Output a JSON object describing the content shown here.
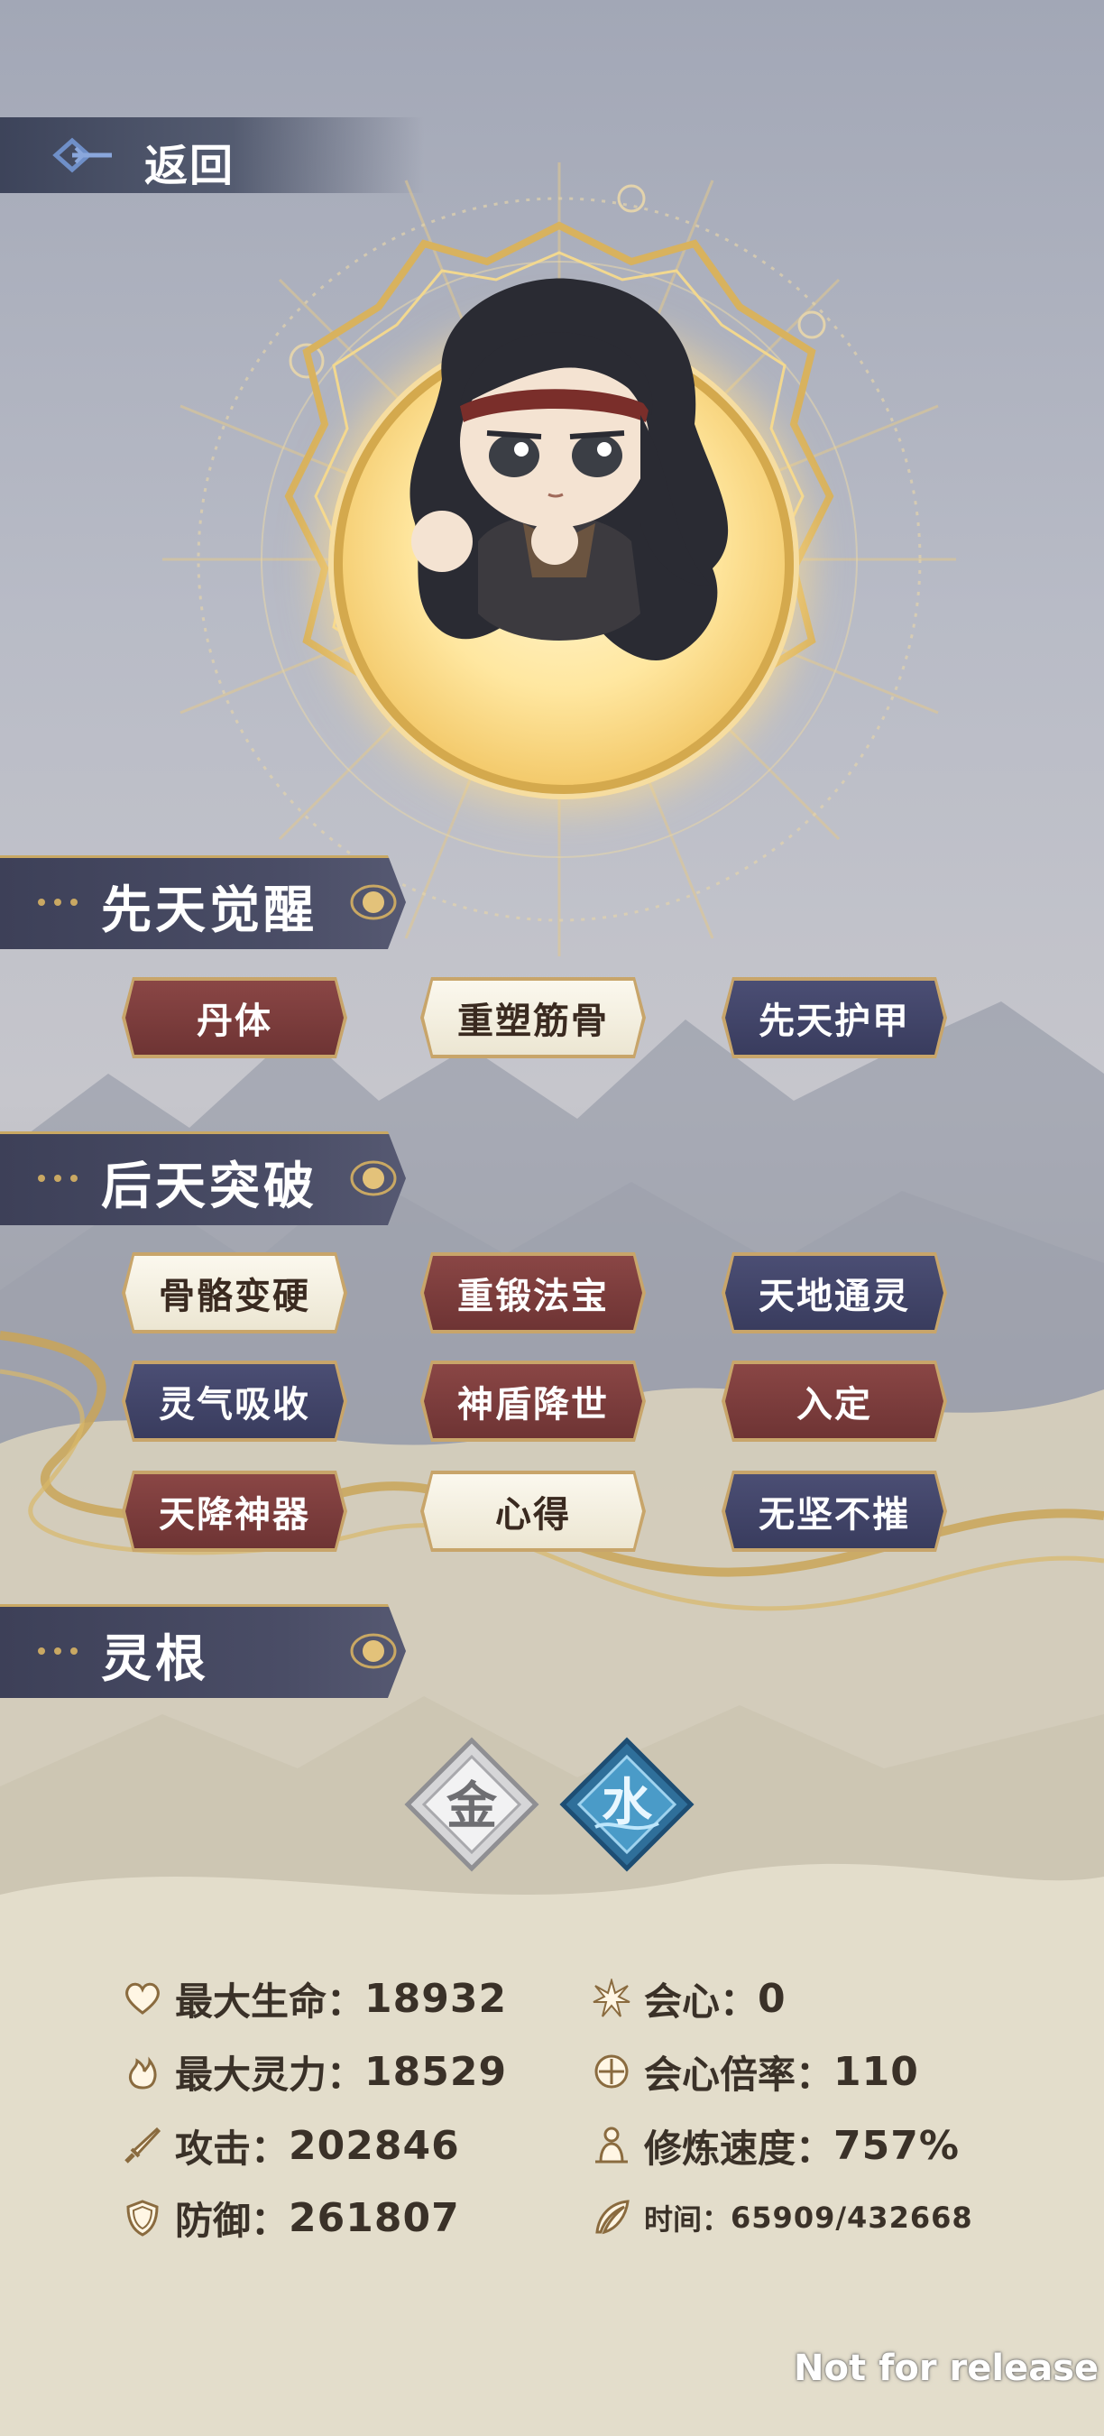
{
  "header": {
    "back_label": "返回"
  },
  "sections": {
    "innate": {
      "title": "先天觉醒",
      "skills": [
        {
          "label": "丹体",
          "style": "red"
        },
        {
          "label": "重塑筋骨",
          "style": "white"
        },
        {
          "label": "先天护甲",
          "style": "blue"
        }
      ]
    },
    "acquired": {
      "title": "后天突破",
      "skills": [
        {
          "label": "骨骼变硬",
          "style": "white"
        },
        {
          "label": "重锻法宝",
          "style": "red"
        },
        {
          "label": "天地通灵",
          "style": "blue"
        },
        {
          "label": "灵气吸收",
          "style": "blue"
        },
        {
          "label": "神盾降世",
          "style": "red"
        },
        {
          "label": "入定",
          "style": "red"
        },
        {
          "label": "天降神器",
          "style": "red"
        },
        {
          "label": "心得",
          "style": "white"
        },
        {
          "label": "无坚不摧",
          "style": "blue"
        }
      ]
    },
    "spirit_root": {
      "title": "灵根",
      "roots": [
        {
          "label": "金",
          "icon": "metal-element-icon"
        },
        {
          "label": "水",
          "icon": "water-element-icon"
        }
      ]
    }
  },
  "stats": {
    "max_hp": {
      "label": "最大生命：",
      "value": "18932",
      "icon": "heart-icon"
    },
    "crit": {
      "label": "会心：",
      "value": "0",
      "icon": "crit-burst-icon"
    },
    "max_mana": {
      "label": "最大灵力：",
      "value": "18529",
      "icon": "flame-icon"
    },
    "crit_multiplier": {
      "label": "会心倍率：",
      "value": "110",
      "icon": "crosshair-icon"
    },
    "attack": {
      "label": "攻击：",
      "value": "202846",
      "icon": "sword-icon"
    },
    "cultivation_speed": {
      "label": "修炼速度：",
      "value": "757%",
      "icon": "meditation-icon"
    },
    "defense": {
      "label": "防御：",
      "value": "261807",
      "icon": "shield-icon"
    },
    "time": {
      "label": "时间：",
      "value": "65909/432668",
      "icon": "feather-icon"
    }
  },
  "watermark": "Not for release",
  "colors": {
    "gold": "#c9a863",
    "band": "#4a4d66",
    "red_button": "#7b3c3c",
    "blue_button": "#43466a",
    "white_button": "#f5f1e3",
    "text_dark": "#3a3128"
  }
}
